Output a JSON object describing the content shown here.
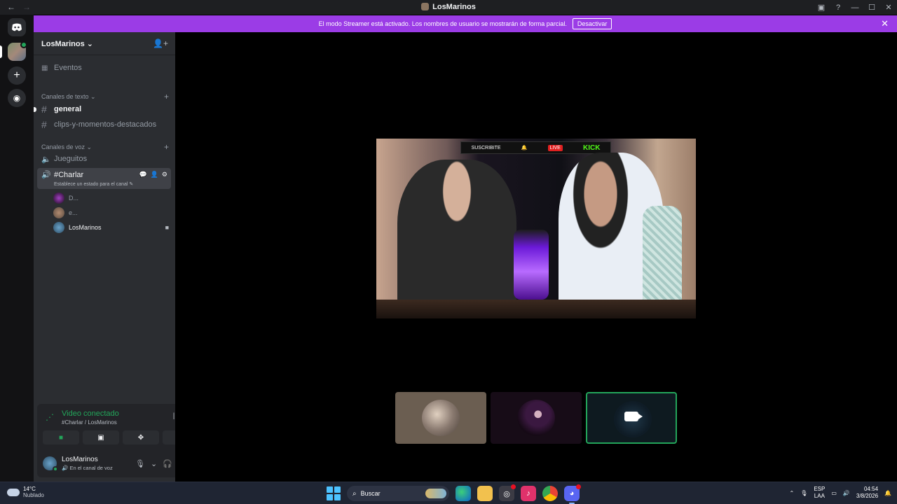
{
  "window": {
    "title": "LosMarinos",
    "back": "←",
    "forward": "→"
  },
  "banner": {
    "text": "El modo Streamer está activado. Los nombres de usuario se mostrarán de forma parcial.",
    "button": "Desactivar",
    "close": "✕"
  },
  "server": {
    "name": "LosMarinos"
  },
  "sidebar": {
    "events": "Eventos",
    "text_category": "Canales de texto",
    "text_channels": [
      {
        "name": "general",
        "unread": true
      },
      {
        "name": "clips-y-momentos-destacados",
        "unread": false
      }
    ],
    "voice_category": "Canales de voz",
    "voice_channels": [
      {
        "name": "Jueguitos"
      },
      {
        "name": "#Charlar",
        "status": "Establece un estado para el canal"
      }
    ],
    "members": [
      {
        "name": "D..."
      },
      {
        "name": "e..."
      },
      {
        "name": "LosMarinos"
      }
    ]
  },
  "voice_panel": {
    "status": "Video conectado",
    "channel": "#Charlar / LosMarinos",
    "user": {
      "name": "LosMarinos",
      "status": "En el canal de voz"
    }
  },
  "stage": {
    "stream_overlay": {
      "subscribe": "SUSCRIBITE",
      "live": "LIVE",
      "platform": "KICK"
    }
  },
  "taskbar": {
    "weather": {
      "temp": "14°C",
      "desc": "Nublado"
    },
    "search": "Buscar",
    "lang": {
      "code": "ESP",
      "layout": "LAA"
    },
    "time": "04:54",
    "date": "3/8/2026"
  },
  "colors": {
    "accent": "#9b3ce6",
    "connected": "#23a55a",
    "sidebar": "#2b2d31",
    "guild_rail": "#121214"
  }
}
